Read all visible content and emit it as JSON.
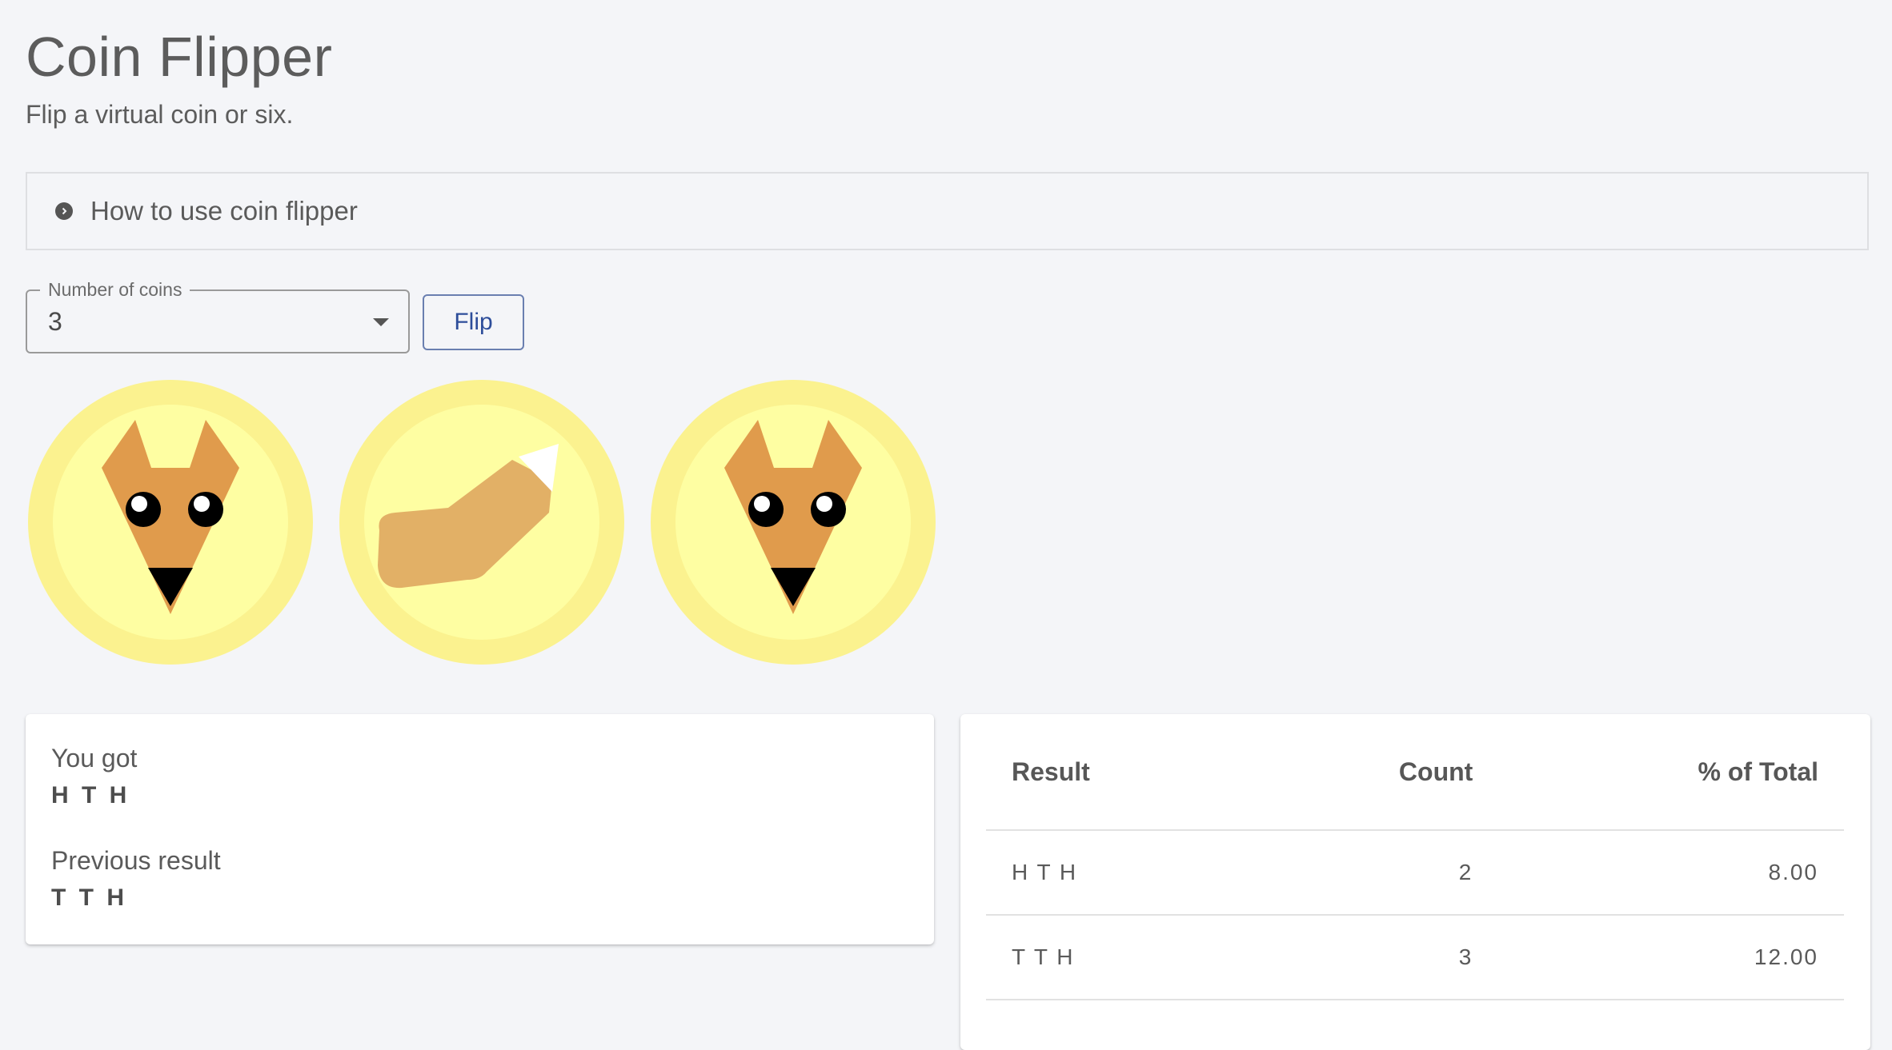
{
  "header": {
    "title": "Coin Flipper",
    "subtitle": "Flip a virtual coin or six."
  },
  "accordion": {
    "label": "How to use coin flipper",
    "icon": "chevron-right-circle-icon"
  },
  "controls": {
    "coin_select_label": "Number of coins",
    "coin_select_value": "3",
    "flip_label": "Flip"
  },
  "coins": [
    {
      "face": "heads",
      "icon": "fox-face-icon"
    },
    {
      "face": "tails",
      "icon": "fox-tail-icon"
    },
    {
      "face": "heads",
      "icon": "fox-face-icon"
    }
  ],
  "result": {
    "current_label": "You got",
    "current_value": "H T H",
    "previous_label": "Previous result",
    "previous_value": "T T H"
  },
  "stats_table": {
    "headers": [
      "Result",
      "Count",
      "% of Total"
    ],
    "rows": [
      [
        "H T H",
        "2",
        "8.00"
      ],
      [
        "T T H",
        "3",
        "12.00"
      ]
    ]
  },
  "colors": {
    "background": "#f4f5f8",
    "coin_outer": "#fbf28f",
    "coin_inner": "#fefea2",
    "fox_orange": "#e09b4c",
    "tail_tan": "#e2b066",
    "accent_blue": "#2d4d9a"
  }
}
